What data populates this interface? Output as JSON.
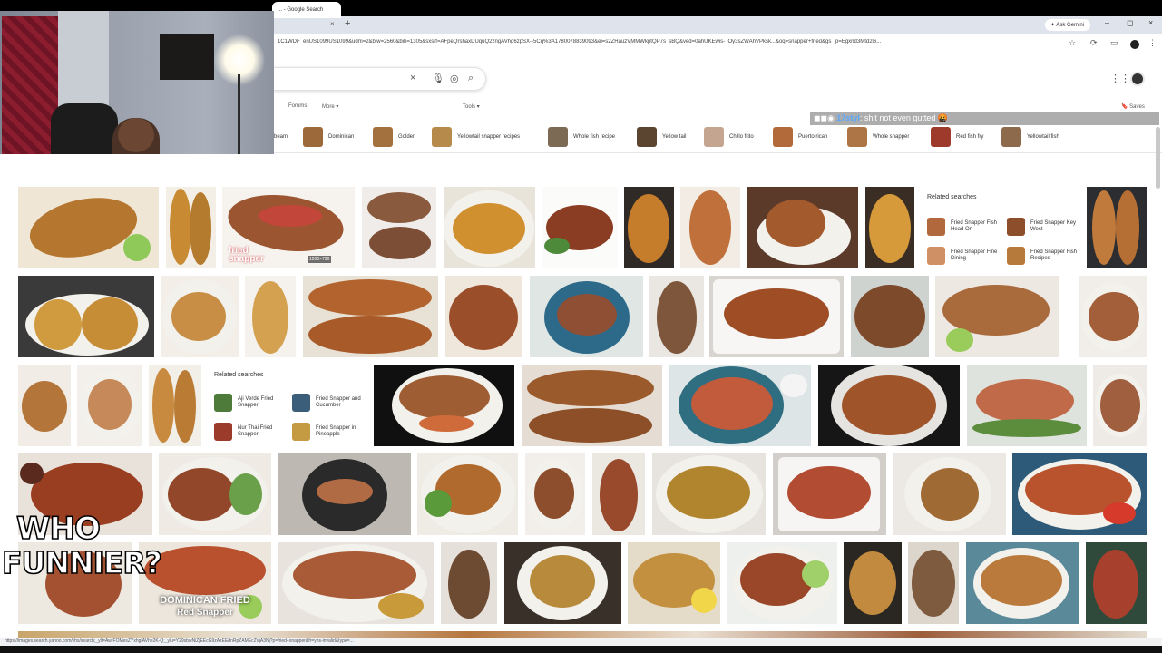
{
  "browser": {
    "tab_title": "... - Google Search",
    "tab_close": "×",
    "new_tab": "+",
    "gemini": "Ask Gemini",
    "win_min": "–",
    "win_max": "◻",
    "win_close": "×",
    "url": "1C1WDF_enUS1099US1099&udm=2&biw=2560&bih=1305&sxsrf=AFpeQrshaxDUquQ2zngAVhg6zpSX--5Cq%3A1780078839093&ei=s2ZHauzVMMWkptQP7s_sBQ&ved=0ahUKEwis-_Oy3sZWAhVPksk...&oq=snapper+fried&gs_lp=Egxnd3Mtd2l6..."
  },
  "search": {
    "clear": "×"
  },
  "nav": [
    "Forums",
    "More ▾",
    "Tools ▾"
  ],
  "saved": "Saves",
  "chat": {
    "user": "17styl",
    "message": ": shit not even gutted 🤬"
  },
  "chips": [
    "beam",
    "Dominican",
    "Golden",
    "Yellowtail snapper recipes",
    "Whole fish recipe",
    "Yellow tail",
    "Chillo frito",
    "Puerto rican",
    "Whole snapper",
    "Red fish fry",
    "Yellowtail fish"
  ],
  "image_labels": {
    "fried_snapper": "fried\nsnapper",
    "dimensions": "1200×720",
    "dominican": "DOMINICAN FRIED",
    "dominican_sub": "Red Snapper"
  },
  "related_1": {
    "title": "Related searches",
    "items": [
      "Fried Snapper Fish Head On",
      "Fried Snapper Key West",
      "Fried Snapper Fine Dining",
      "Fried Snapper Fish Recipes"
    ]
  },
  "related_2": {
    "title": "Related searches",
    "items": [
      "Aji Verde Fried Snapper",
      "Fried Snapper and Cucumber",
      "Nur Thai Fried Snapper",
      "Fried Snapper in Pineapple"
    ]
  },
  "overlay": {
    "who": "WHO",
    "funnier": "FUNNIER?"
  },
  "status_url": "https://images.search.yahoo.com/yhs/search;_ylt=AwrFOMesZYxhgIAVhe2K-Q;_ylu=Y29sbwNiZjEEcG9zAzEEdnRpZAMEc2VjA3Nj?p=fried+snapper&fr=yhs-invalid&type=..."
}
